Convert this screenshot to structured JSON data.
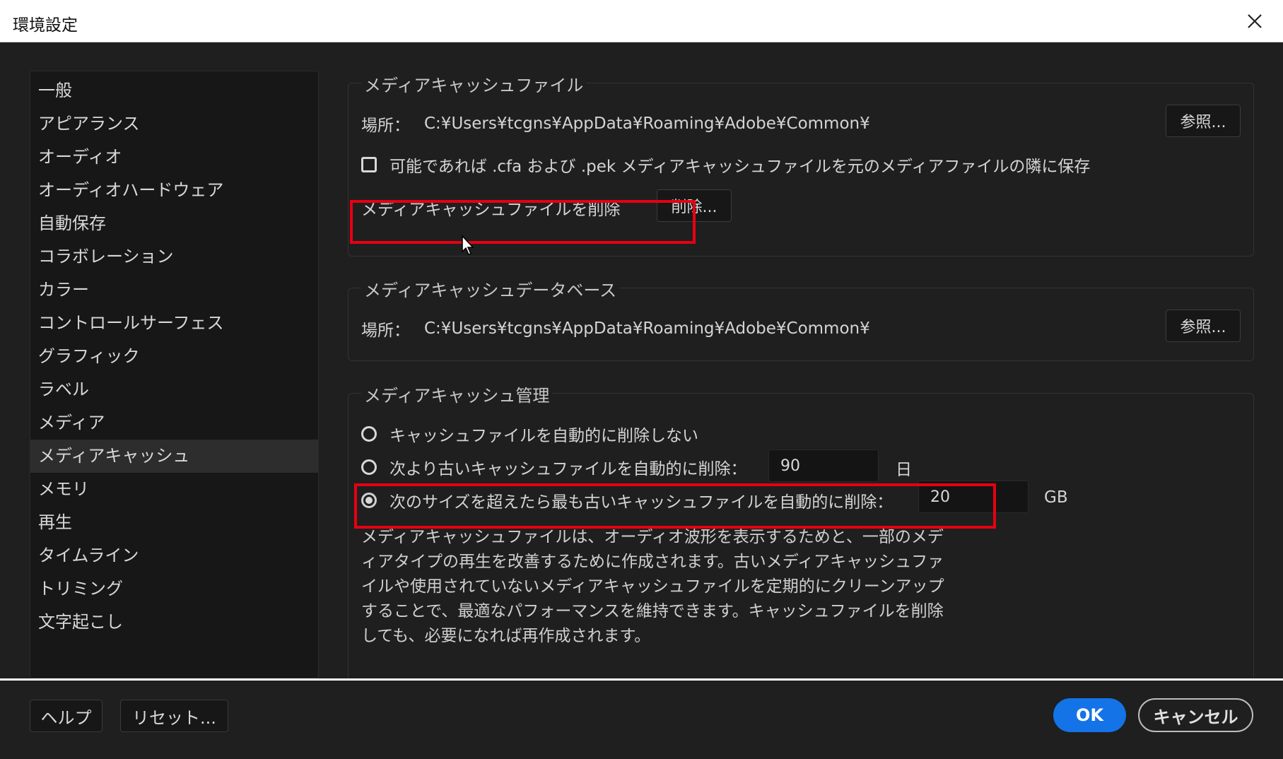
{
  "window": {
    "title": "環境設定",
    "close_icon": "close-icon"
  },
  "sidebar": {
    "items": [
      {
        "label": "一般"
      },
      {
        "label": "アピアランス"
      },
      {
        "label": "オーディオ"
      },
      {
        "label": "オーディオハードウェア"
      },
      {
        "label": "自動保存"
      },
      {
        "label": "コラボレーション"
      },
      {
        "label": "カラー"
      },
      {
        "label": "コントロールサーフェス"
      },
      {
        "label": "グラフィック"
      },
      {
        "label": "ラベル"
      },
      {
        "label": "メディア"
      },
      {
        "label": "メディアキャッシュ",
        "active": true
      },
      {
        "label": "メモリ"
      },
      {
        "label": "再生"
      },
      {
        "label": "タイムライン"
      },
      {
        "label": "トリミング"
      },
      {
        "label": "文字起こし"
      }
    ]
  },
  "cache_files": {
    "legend": "メディアキャッシュファイル",
    "location_label": "場所：",
    "location_path": "C:¥Users¥tcgns¥AppData¥Roaming¥Adobe¥Common¥",
    "browse_label": "参照...",
    "save_next_label": "可能であれば .cfa および .pek メディアキャッシュファイルを元のメディアファイルの隣に保存",
    "save_next_checked": false,
    "delete_label": "メディアキャッシュファイルを削除",
    "delete_button": "削除..."
  },
  "cache_db": {
    "legend": "メディアキャッシュデータベース",
    "location_label": "場所：",
    "location_path": "C:¥Users¥tcgns¥AppData¥Roaming¥Adobe¥Common¥",
    "browse_label": "参照..."
  },
  "cache_management": {
    "legend": "メディアキャッシュ管理",
    "option_no_delete": "キャッシュファイルを自動的に削除しない",
    "option_older": "次より古いキャッシュファイルを自動的に削除：",
    "older_value": "90",
    "older_unit": "日",
    "option_size": "次のサイズを超えたら最も古いキャッシュファイルを自動的に削除：",
    "size_value": "20",
    "size_unit": "GB",
    "selected": "size",
    "description": "メディアキャッシュファイルは、オーディオ波形を表示するためと、一部のメディアタイプの再生を改善するために作成されます。古いメディアキャッシュファイルや使用されていないメディアキャッシュファイルを定期的にクリーンアップすることで、最適なパフォーマンスを維持できます。キャッシュファイルを削除しても、必要になれば再作成されます。"
  },
  "footer": {
    "help": "ヘルプ",
    "reset": "リセット...",
    "ok": "OK",
    "cancel": "キャンセル"
  },
  "colors": {
    "accent": "#1473e6",
    "highlight": "#e60012",
    "background": "#1f1f1f"
  }
}
